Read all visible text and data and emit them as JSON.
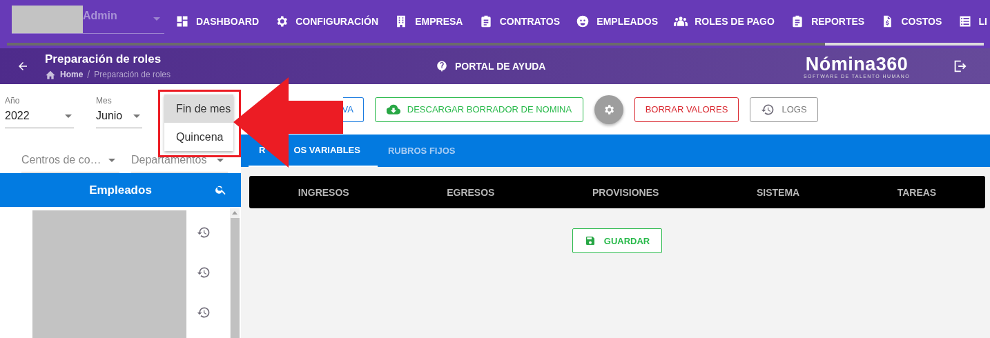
{
  "account": {
    "name": "Admin"
  },
  "nav": [
    {
      "label": "DASHBOARD"
    },
    {
      "label": "CONFIGURACIÓN"
    },
    {
      "label": "EMPRESA"
    },
    {
      "label": "CONTRATOS"
    },
    {
      "label": "EMPLEADOS"
    },
    {
      "label": "ROLES DE PAGO"
    },
    {
      "label": "REPORTES"
    },
    {
      "label": "COSTOS"
    },
    {
      "label": "LI"
    }
  ],
  "header": {
    "title": "Preparación de roles",
    "breadcrumb": [
      {
        "label": "Home"
      },
      {
        "label": "Preparación de roles"
      }
    ],
    "separator": "/",
    "help": "PORTAL DE AYUDA",
    "logo": {
      "name": "Nómina360",
      "tagline": "SOFTWARE DE TALENTO HUMANO"
    }
  },
  "filters": [
    {
      "label": "Año",
      "value": "2022"
    },
    {
      "label": "Mes",
      "value": "Junio"
    }
  ],
  "period_menu": [
    {
      "label": "Fin de mes",
      "selected": true
    },
    {
      "label": "Quincena",
      "selected": false
    }
  ],
  "filters_2": [
    {
      "placeholder": "Centros de co…"
    },
    {
      "placeholder": "Departamentos"
    }
  ],
  "employees_panel": {
    "title": "Empleados"
  },
  "actions": [
    {
      "kind": "primary",
      "label": "VA"
    },
    {
      "kind": "success",
      "label": "DESCARGAR BORRADOR DE NOMINA"
    },
    {
      "kind": "gear"
    },
    {
      "kind": "danger",
      "label": "BORRAR VALORES"
    },
    {
      "kind": "history",
      "label": "LOGS"
    }
  ],
  "tabs": [
    {
      "label_parts": [
        "R",
        "OS VARIABLES"
      ],
      "selected": true
    },
    {
      "label_parts": [
        "RUBROS FIJOS"
      ],
      "selected": false
    }
  ],
  "sections": [
    "INGRESOS",
    "EGRESOS",
    "PROVISIONES",
    "SISTEMA",
    "TAREAS"
  ],
  "save_button": {
    "label": "GUARDAR"
  }
}
